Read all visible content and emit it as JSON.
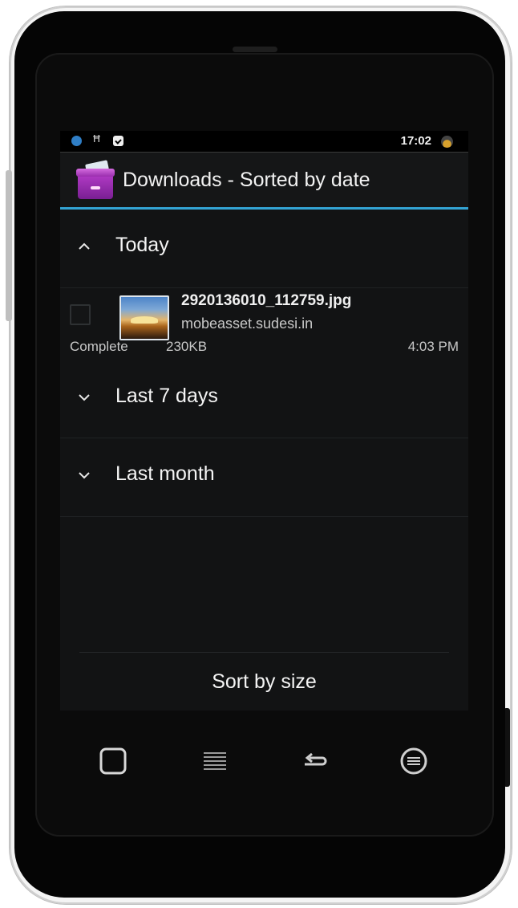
{
  "status_bar": {
    "time": "17:02",
    "icons": [
      "globe-icon",
      "usb-icon",
      "calendar-check-icon",
      "battery-icon"
    ]
  },
  "action_bar": {
    "title": "Downloads - Sorted by date",
    "icon": "downloads-app-icon",
    "accent_color": "#33a4d4"
  },
  "groups": [
    {
      "label": "Today",
      "expanded": true
    },
    {
      "label": "Last 7 days",
      "expanded": false
    },
    {
      "label": "Last month",
      "expanded": false
    }
  ],
  "download_item": {
    "file_name": "2920136010_112759.jpg",
    "host": "mobeasset.sudesi.in",
    "status": "Complete",
    "size": "230KB",
    "time": "4:03 PM",
    "checked": false
  },
  "footer": {
    "sort_button_label": "Sort by size"
  },
  "hardware_keys": [
    "home-key-icon",
    "menu-key-icon",
    "back-key-icon",
    "search-key-icon"
  ]
}
